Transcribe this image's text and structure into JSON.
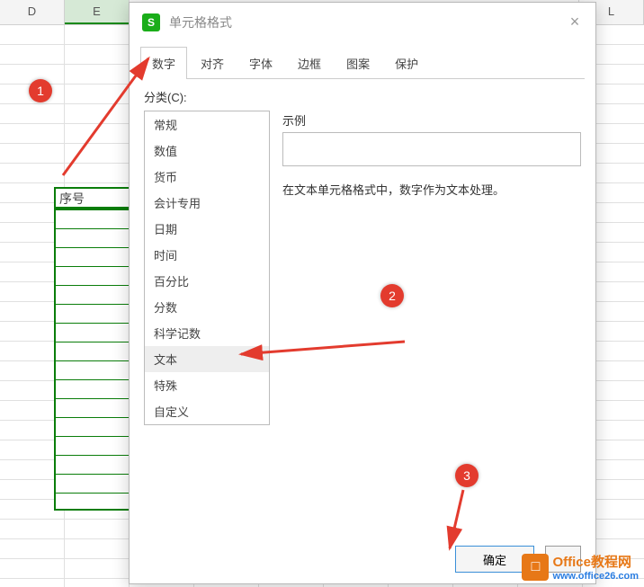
{
  "columns": [
    "D",
    "E",
    "",
    "",
    "",
    "",
    "",
    "L"
  ],
  "selected_cell_label": "序号",
  "dialog": {
    "title": "单元格格式",
    "tabs": [
      "数字",
      "对齐",
      "字体",
      "边框",
      "图案",
      "保护"
    ],
    "active_tab_index": 0,
    "category_label": "分类(C):",
    "categories": [
      "常规",
      "数值",
      "货币",
      "会计专用",
      "日期",
      "时间",
      "百分比",
      "分数",
      "科学记数",
      "文本",
      "特殊",
      "自定义"
    ],
    "selected_category_index": 9,
    "sample_label": "示例",
    "sample_value": "",
    "description": "在文本单元格格式中，数字作为文本处理。",
    "ok_label": "确定",
    "cancel_label": ""
  },
  "annotations": {
    "b1": "1",
    "b2": "2",
    "b3": "3"
  },
  "watermark": {
    "line1": "Office教程网",
    "line2": "www.office26.com"
  },
  "colors": {
    "accent_green": "#1aad19",
    "annotation_red": "#e33b2e",
    "brand_orange": "#e77817",
    "brand_blue": "#2a7de1"
  }
}
